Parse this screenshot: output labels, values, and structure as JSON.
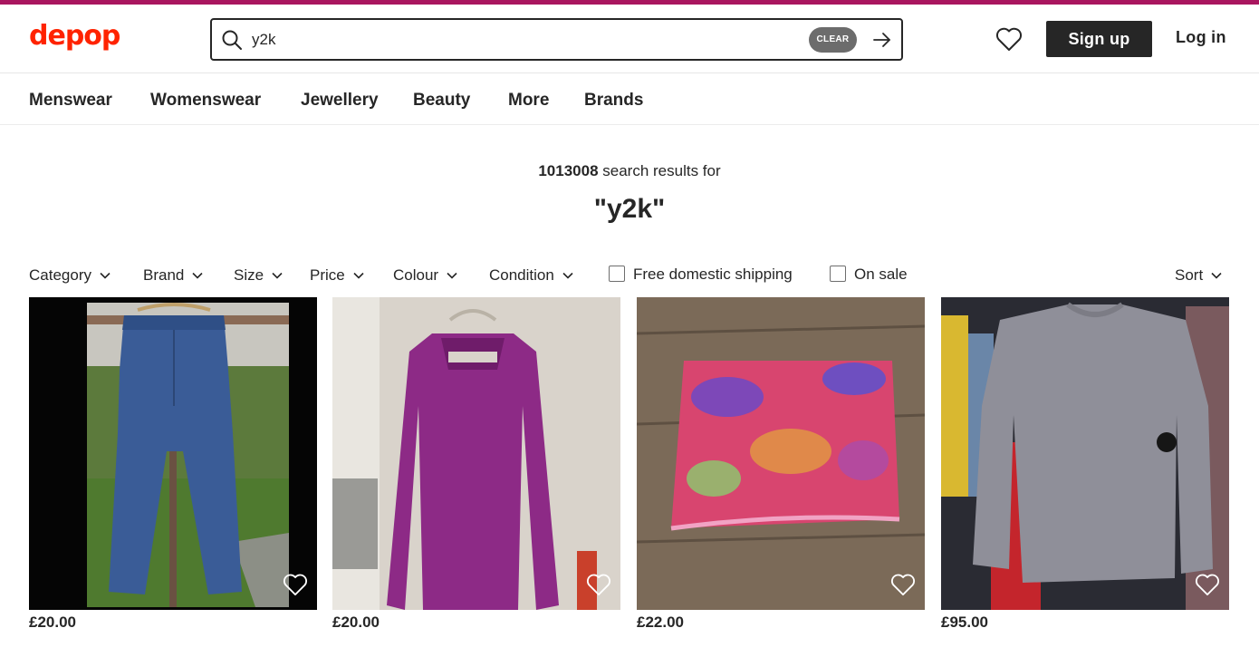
{
  "brand": {
    "logo_text": "depop",
    "logo_color": "#ff2300",
    "accent_bar_color": "#a9165f"
  },
  "search": {
    "value": "y2k",
    "clear_label": "CLEAR"
  },
  "header": {
    "signup_label": "Sign up",
    "login_label": "Log in"
  },
  "nav": {
    "items": [
      "Menswear",
      "Womenswear",
      "Jewellery",
      "Beauty",
      "More",
      "Brands"
    ]
  },
  "results": {
    "count": "1013008",
    "count_suffix": "search results for",
    "query": "\"y2k\""
  },
  "filters": {
    "dropdowns": [
      "Category",
      "Brand",
      "Size",
      "Price",
      "Colour",
      "Condition"
    ],
    "checkboxes": [
      "Free domestic shipping",
      "On sale"
    ],
    "sort_label": "Sort"
  },
  "products": [
    {
      "price": "£20.00",
      "image": "blue denim jeans on hanger"
    },
    {
      "price": "£20.00",
      "image": "purple long sleeve dress on hanger"
    },
    {
      "price": "£22.00",
      "image": "pink psychedelic print mini skirt"
    },
    {
      "price": "£95.00",
      "image": "grey knit jumper on rail"
    }
  ]
}
